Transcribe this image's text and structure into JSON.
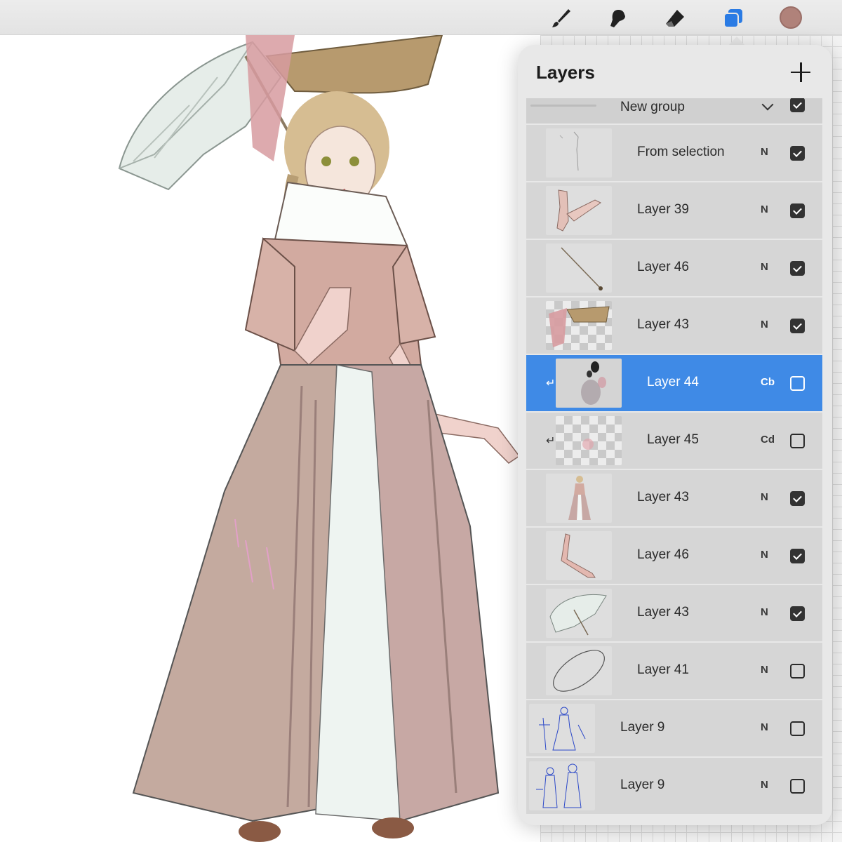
{
  "toolbar": {
    "tools": [
      {
        "name": "brush-icon",
        "left": 0
      },
      {
        "name": "smudge-icon",
        "left": 0
      },
      {
        "name": "eraser-icon",
        "left": 0
      },
      {
        "name": "layers-icon",
        "active": true
      }
    ],
    "current_color": "#b0827a",
    "active_color": "#2a7be4"
  },
  "panel": {
    "title": "Layers",
    "add_icon": "plus-icon",
    "group": {
      "label": "New group",
      "visible": true,
      "icon": "chevron-down-icon"
    },
    "layers": [
      {
        "name": "From selection",
        "blend": "N",
        "visible": true,
        "thumb": "sketch-lines",
        "clipped": false,
        "selected": false
      },
      {
        "name": "Layer 39",
        "blend": "N",
        "visible": true,
        "thumb": "arm",
        "clipped": false,
        "selected": false
      },
      {
        "name": "Layer 46",
        "blend": "N",
        "visible": true,
        "thumb": "parasol-stick",
        "clipped": false,
        "selected": false
      },
      {
        "name": "Layer 43",
        "blend": "N",
        "visible": true,
        "thumb": "hat",
        "clipped": false,
        "selected": false
      },
      {
        "name": "Layer 44",
        "blend": "Cb",
        "visible": false,
        "thumb": "blur",
        "clipped": true,
        "selected": true
      },
      {
        "name": "Layer 45",
        "blend": "Cd",
        "visible": false,
        "thumb": "transparent-pink",
        "clipped": true,
        "selected": false
      },
      {
        "name": "Layer 43",
        "blend": "N",
        "visible": true,
        "thumb": "figure",
        "clipped": false,
        "selected": false
      },
      {
        "name": "Layer 46",
        "blend": "N",
        "visible": true,
        "thumb": "forearm",
        "clipped": false,
        "selected": false
      },
      {
        "name": "Layer 43",
        "blend": "N",
        "visible": true,
        "thumb": "umbrella",
        "clipped": false,
        "selected": false
      },
      {
        "name": "Layer 41",
        "blend": "N",
        "visible": false,
        "thumb": "ellipse",
        "clipped": false,
        "selected": false
      },
      {
        "name": "Layer 9",
        "blend": "N",
        "visible": false,
        "thumb": "blue-sketch-single",
        "clipped": false,
        "selected": false,
        "outdented": true
      },
      {
        "name": "Layer 9",
        "blend": "N",
        "visible": false,
        "thumb": "blue-sketch-pair",
        "clipped": false,
        "selected": false,
        "outdented": true
      }
    ]
  },
  "clip_glyph": "↵"
}
